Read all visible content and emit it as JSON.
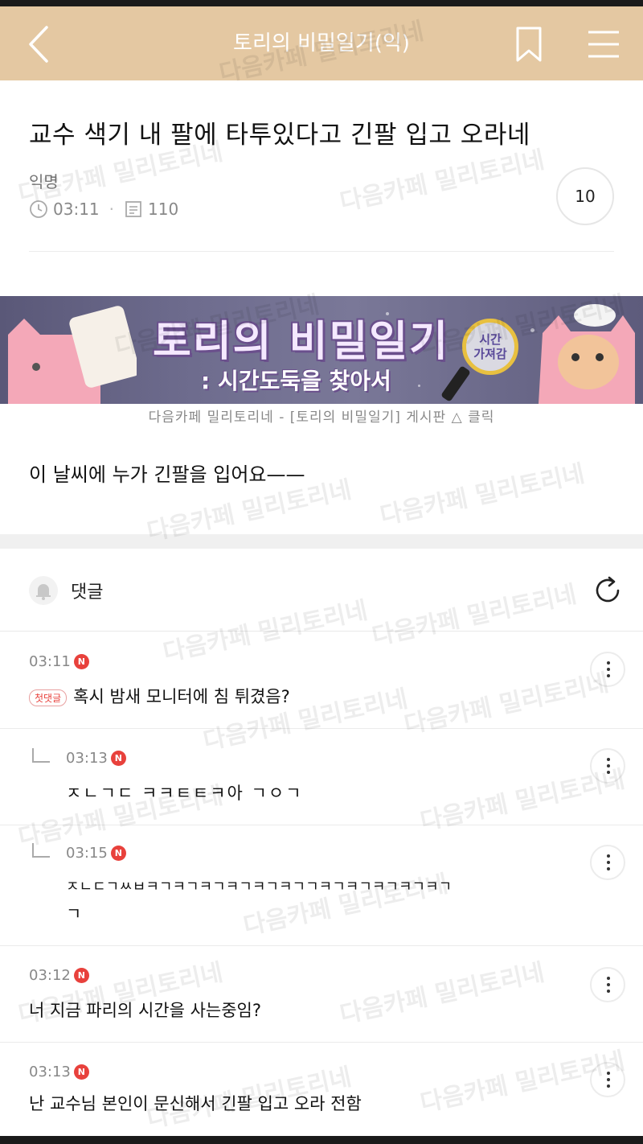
{
  "header": {
    "title": "토리의 비밀일기(익)",
    "bg_color": "#e4c8a2",
    "back_icon": "chevron-left-icon",
    "bookmark_icon": "bookmark-icon",
    "menu_icon": "hamburger-menu-icon"
  },
  "post": {
    "title": "교수 색기 내 팔에 타투있다고 긴팔 입고 오라네",
    "author": "익명",
    "time": "03:11",
    "views": "110",
    "likes": "10",
    "body": "이 날씨에 누가 긴팔을 입어요——"
  },
  "banner": {
    "line1": "토리의 비밀일기",
    "line2": ": 시간도둑을 찾아서",
    "lens_text": "시간\n가져감",
    "caption": "다음카페 밀리토리네 - [토리의 비밀일기] 게시판 △ 클릭"
  },
  "comments_section": {
    "label": "댓글",
    "bell_icon": "bell-icon",
    "refresh_icon": "refresh-icon"
  },
  "comments": [
    {
      "time": "03:11",
      "badge": "N",
      "first_label": "첫댓글",
      "text": "혹시 밤새 모니터에 침 튀겼음?",
      "reply": false
    },
    {
      "time": "03:13",
      "badge": "N",
      "text": "ㅈㄴㄱㄷ ㅋㅋㅌㅌㅋ아 ㄱㅇㄱ",
      "reply": true
    },
    {
      "time": "03:15",
      "badge": "N",
      "text": "ㅈㄴㄷㄱㅆㅂㅋㄱㅋㄱㅋㄱㅋㄱㅋㄱㅋㄱㄱㅋㄱㅋㄱㅋㄱㅋㄱㅋㄱ",
      "text2": "ㄱ",
      "reply": true
    },
    {
      "time": "03:12",
      "badge": "N",
      "text": "너 지금 파리의 시간을 사는중임?",
      "reply": false
    },
    {
      "time": "03:13",
      "badge": "N",
      "text": "난 교수님 본인이 문신해서 긴팔 입고 오라 전함",
      "reply": false
    }
  ],
  "watermark": "다음카페 밀리토리네",
  "colors": {
    "accent_red": "#e8413c",
    "header": "#e4c8a2"
  }
}
